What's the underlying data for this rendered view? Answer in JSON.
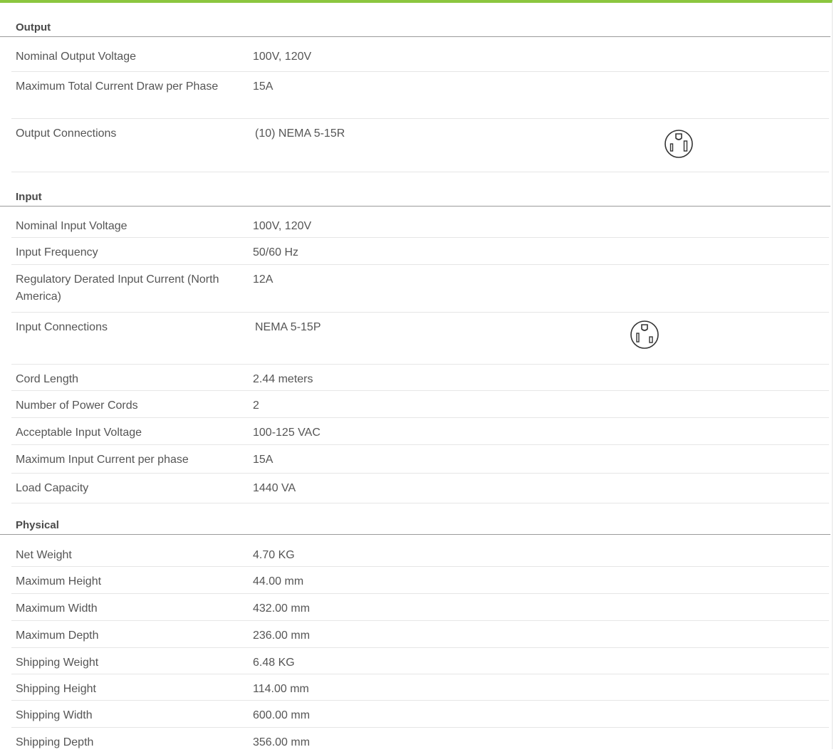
{
  "sections": {
    "output": {
      "title": "Output",
      "rows": [
        {
          "label": "Nominal Output Voltage",
          "value": "100V, 120V"
        },
        {
          "label": "Maximum Total Current Draw per Phase",
          "value": "15A"
        },
        {
          "label": "Output Connections",
          "value": "(10) NEMA 5-15R",
          "icon": "nema-5-15r-receptacle-icon"
        }
      ]
    },
    "input": {
      "title": "Input",
      "rows": [
        {
          "label": "Nominal Input Voltage",
          "value": "100V, 120V"
        },
        {
          "label": "Input Frequency",
          "value": "50/60 Hz"
        },
        {
          "label": "Regulatory Derated Input Current (North America)",
          "value": "12A"
        },
        {
          "label": "Input Connections",
          "value": "NEMA 5-15P",
          "icon": "nema-5-15p-plug-icon"
        },
        {
          "label": "Cord Length",
          "value": "2.44 meters"
        },
        {
          "label": "Number of Power Cords",
          "value": "2"
        },
        {
          "label": "Acceptable Input Voltage",
          "value": "100-125 VAC"
        },
        {
          "label": "Maximum Input Current per phase",
          "value": "15A"
        },
        {
          "label": "Load Capacity",
          "value": "1440 VA"
        }
      ]
    },
    "physical": {
      "title": "Physical",
      "rows": [
        {
          "label": "Net Weight",
          "value": "4.70 KG"
        },
        {
          "label": "Maximum Height",
          "value": "44.00 mm"
        },
        {
          "label": "Maximum Width",
          "value": "432.00 mm"
        },
        {
          "label": "Maximum Depth",
          "value": "236.00 mm"
        },
        {
          "label": "Shipping Weight",
          "value": "6.48 KG"
        },
        {
          "label": "Shipping Height",
          "value": "114.00 mm"
        },
        {
          "label": "Shipping Width",
          "value": "600.00 mm"
        },
        {
          "label": "Shipping Depth",
          "value": "356.00 mm"
        }
      ]
    }
  },
  "colors": {
    "accent_bar": "#8cc63f",
    "text": "#555555",
    "header_rule": "#9a9a9a",
    "row_rule": "#e6e6e6"
  }
}
